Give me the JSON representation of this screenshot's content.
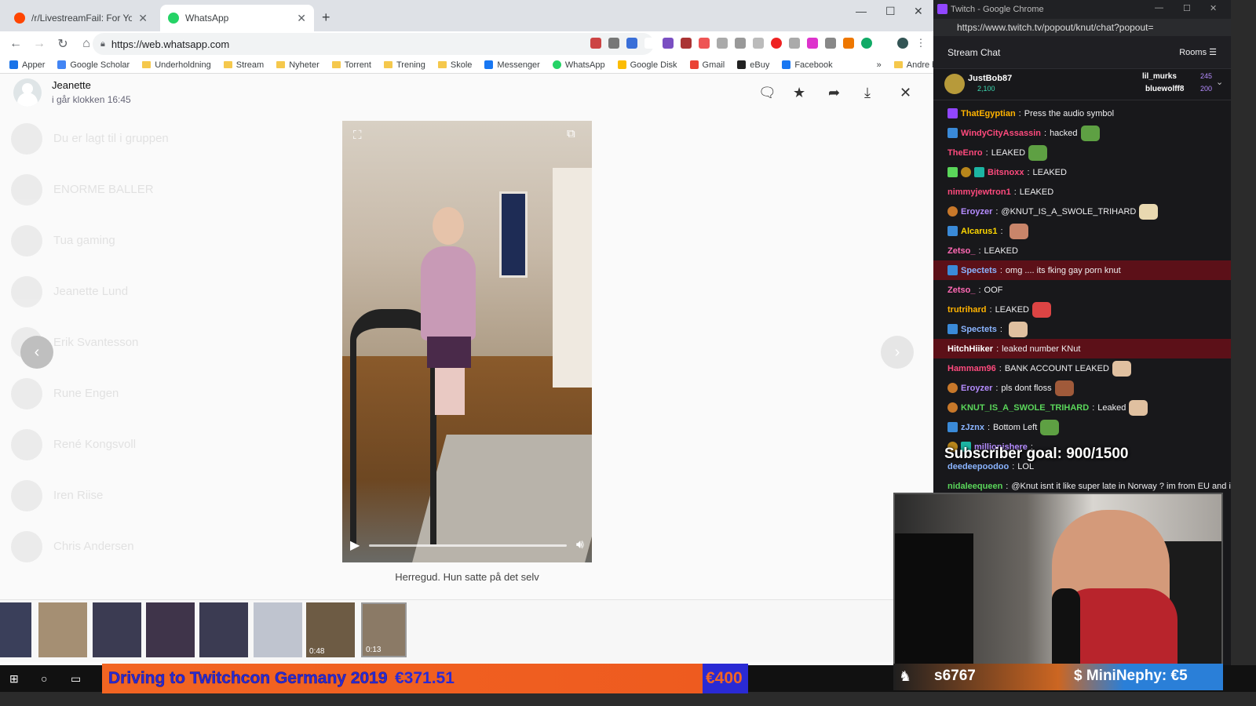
{
  "left_window": {
    "tabs": [
      {
        "label": "/r/LivestreamFail: For Your Win o",
        "favicon_color": "#ff4500"
      },
      {
        "label": "WhatsApp",
        "favicon_color": "#25d366"
      }
    ],
    "url": "https://web.whatsapp.com",
    "bookmarks": [
      {
        "label": "Apper",
        "icon": "apps-grid-icon"
      },
      {
        "label": "Google Scholar",
        "icon": "scholar-icon"
      },
      {
        "label": "Underholdning",
        "icon": "folder-icon"
      },
      {
        "label": "Stream",
        "icon": "folder-icon"
      },
      {
        "label": "Nyheter",
        "icon": "folder-icon"
      },
      {
        "label": "Torrent",
        "icon": "folder-icon"
      },
      {
        "label": "Trening",
        "icon": "folder-icon"
      },
      {
        "label": "Skole",
        "icon": "folder-icon"
      },
      {
        "label": "Messenger",
        "icon": "facebook-icon"
      },
      {
        "label": "WhatsApp",
        "icon": "whatsapp-icon"
      },
      {
        "label": "Google Disk",
        "icon": "drive-icon"
      },
      {
        "label": "Gmail",
        "icon": "gmail-icon"
      },
      {
        "label": "eBuy",
        "icon": "ebay-icon"
      },
      {
        "label": "Facebook",
        "icon": "facebook-icon"
      }
    ],
    "bookmarks_more": "»",
    "other_bookmarks": "Andre bokmerker",
    "viewer": {
      "contact_name": "Jeanette",
      "contact_time": "i går klokken 16:45",
      "caption": "Herregud. Hun satte på det selv",
      "icons": [
        "message-icon",
        "star-icon",
        "forward-icon",
        "download-icon",
        "close-icon"
      ],
      "thumbnail_durations": [
        "0:48",
        "0:13"
      ]
    },
    "background_list": [
      "Du er lagt til i gruppen",
      "ENORME BALLER",
      "Tua gaming",
      "Jeanette Lund",
      "Erik Svantesson",
      "Rune Engen",
      "René Kongsvoll",
      "Iren Riise",
      "Chris Andersen"
    ]
  },
  "right_window": {
    "title": "Twitch - Google Chrome",
    "url": "https://www.twitch.tv/popout/knut/chat?popout=",
    "header": "Stream Chat",
    "rooms": "Rooms",
    "top_gifters": [
      {
        "name": "JustBob87",
        "amount": "2,100"
      },
      {
        "name": "lil_murks",
        "amount": "245"
      },
      {
        "name": "bluewolff8",
        "amount": "200"
      }
    ],
    "messages": [
      {
        "user": "ThatEgyptian",
        "color": "#ffb300",
        "text": "Press the audio symbol",
        "hl": false
      },
      {
        "user": "WindyCityAssassin",
        "color": "#ff4a7d",
        "text": "hacked",
        "hl": false
      },
      {
        "user": "TheEnro",
        "color": "#ff4a7d",
        "text": "LEAKED",
        "hl": false
      },
      {
        "user": "Bitsnoxx",
        "color": "#ff4a7d",
        "text": "LEAKED",
        "hl": false
      },
      {
        "user": "nimmyjewtron1",
        "color": "#ff4a7d",
        "text": "LEAKED",
        "hl": false
      },
      {
        "user": "Eroyzer",
        "color": "#b58cff",
        "text": "@KNUT_IS_A_SWOLE_TRIHARD",
        "hl": false
      },
      {
        "user": "Alcarus1",
        "color": "#ffd700",
        "text": "",
        "hl": false
      },
      {
        "user": "Zetso_",
        "color": "#ff69b4",
        "text": "LEAKED",
        "hl": false
      },
      {
        "user": "Spectets",
        "color": "#8ab4ff",
        "text": "omg .... its fking gay porn knut",
        "hl": true
      },
      {
        "user": "Zetso_",
        "color": "#ff69b4",
        "text": "OOF",
        "hl": false
      },
      {
        "user": "trutrihard",
        "color": "#ffb300",
        "text": "LEAKED",
        "hl": false
      },
      {
        "user": "Spectets",
        "color": "#8ab4ff",
        "text": "",
        "hl": false
      },
      {
        "user": "HitchHiiker",
        "color": "#ffffff",
        "text": "leaked number KNut",
        "hl": true
      },
      {
        "user": "Hammam96",
        "color": "#ff4a7d",
        "text": "BANK ACCOUNT LEAKED",
        "hl": false
      },
      {
        "user": "Eroyzer",
        "color": "#b58cff",
        "text": "pls dont floss",
        "hl": false
      },
      {
        "user": "KNUT_IS_A_SWOLE_TRIHARD",
        "color": "#5ad65a",
        "text": "Leaked",
        "hl": false
      },
      {
        "user": "zJznx",
        "color": "#8ab4ff",
        "text": "Bottom Left",
        "hl": false
      },
      {
        "user": "millionishere",
        "color": "#b58cff",
        "text": "",
        "hl": false
      },
      {
        "user": "deedeepoodoo",
        "color": "#8ab4ff",
        "text": "LOL",
        "hl": false
      },
      {
        "user": "nidaleequeen",
        "color": "#5ad65a",
        "text": "@Knut isnt it like super late in Norway ? im from EU and its",
        "hl": false
      }
    ]
  },
  "overlays": {
    "subscriber_goal": "Subscriber goal: 900/1500",
    "donation_goal_title": "Driving to Twitchcon Germany 2019",
    "donation_goal_amount": "€371.51",
    "donation_goal_target": "€400",
    "latest_sub": "s6767",
    "latest_donation": "$ MiniNephy: €5"
  }
}
